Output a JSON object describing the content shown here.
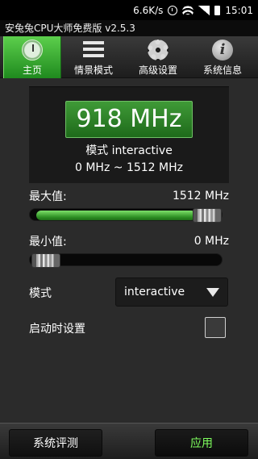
{
  "status": {
    "speed": "6.6K/s",
    "time": "15:01"
  },
  "app": {
    "title": "安兔兔CPU大师免费版 v2.5.3"
  },
  "tabs": [
    {
      "label": "主页",
      "icon": "clock-icon"
    },
    {
      "label": "情景模式",
      "icon": "list-icon"
    },
    {
      "label": "高级设置",
      "icon": "gear-icon"
    },
    {
      "label": "系统信息",
      "icon": "info-icon"
    }
  ],
  "panel": {
    "frequency": "918 MHz",
    "mode_line": "模式 interactive",
    "range_line": "0 MHz ~ 1512 MHz"
  },
  "max": {
    "label": "最大值:",
    "value": "1512 MHz",
    "level": 1.0
  },
  "min": {
    "label": "最小值:",
    "value": "0 MHz",
    "level": 0.0
  },
  "mode": {
    "label": "模式",
    "selected": "interactive"
  },
  "boot": {
    "label": "启动时设置",
    "checked": false
  },
  "buttons": {
    "test": "系统评测",
    "apply": "应用"
  },
  "colors": {
    "accent": "#2f9a2a",
    "apply_text": "#7fff5e"
  }
}
